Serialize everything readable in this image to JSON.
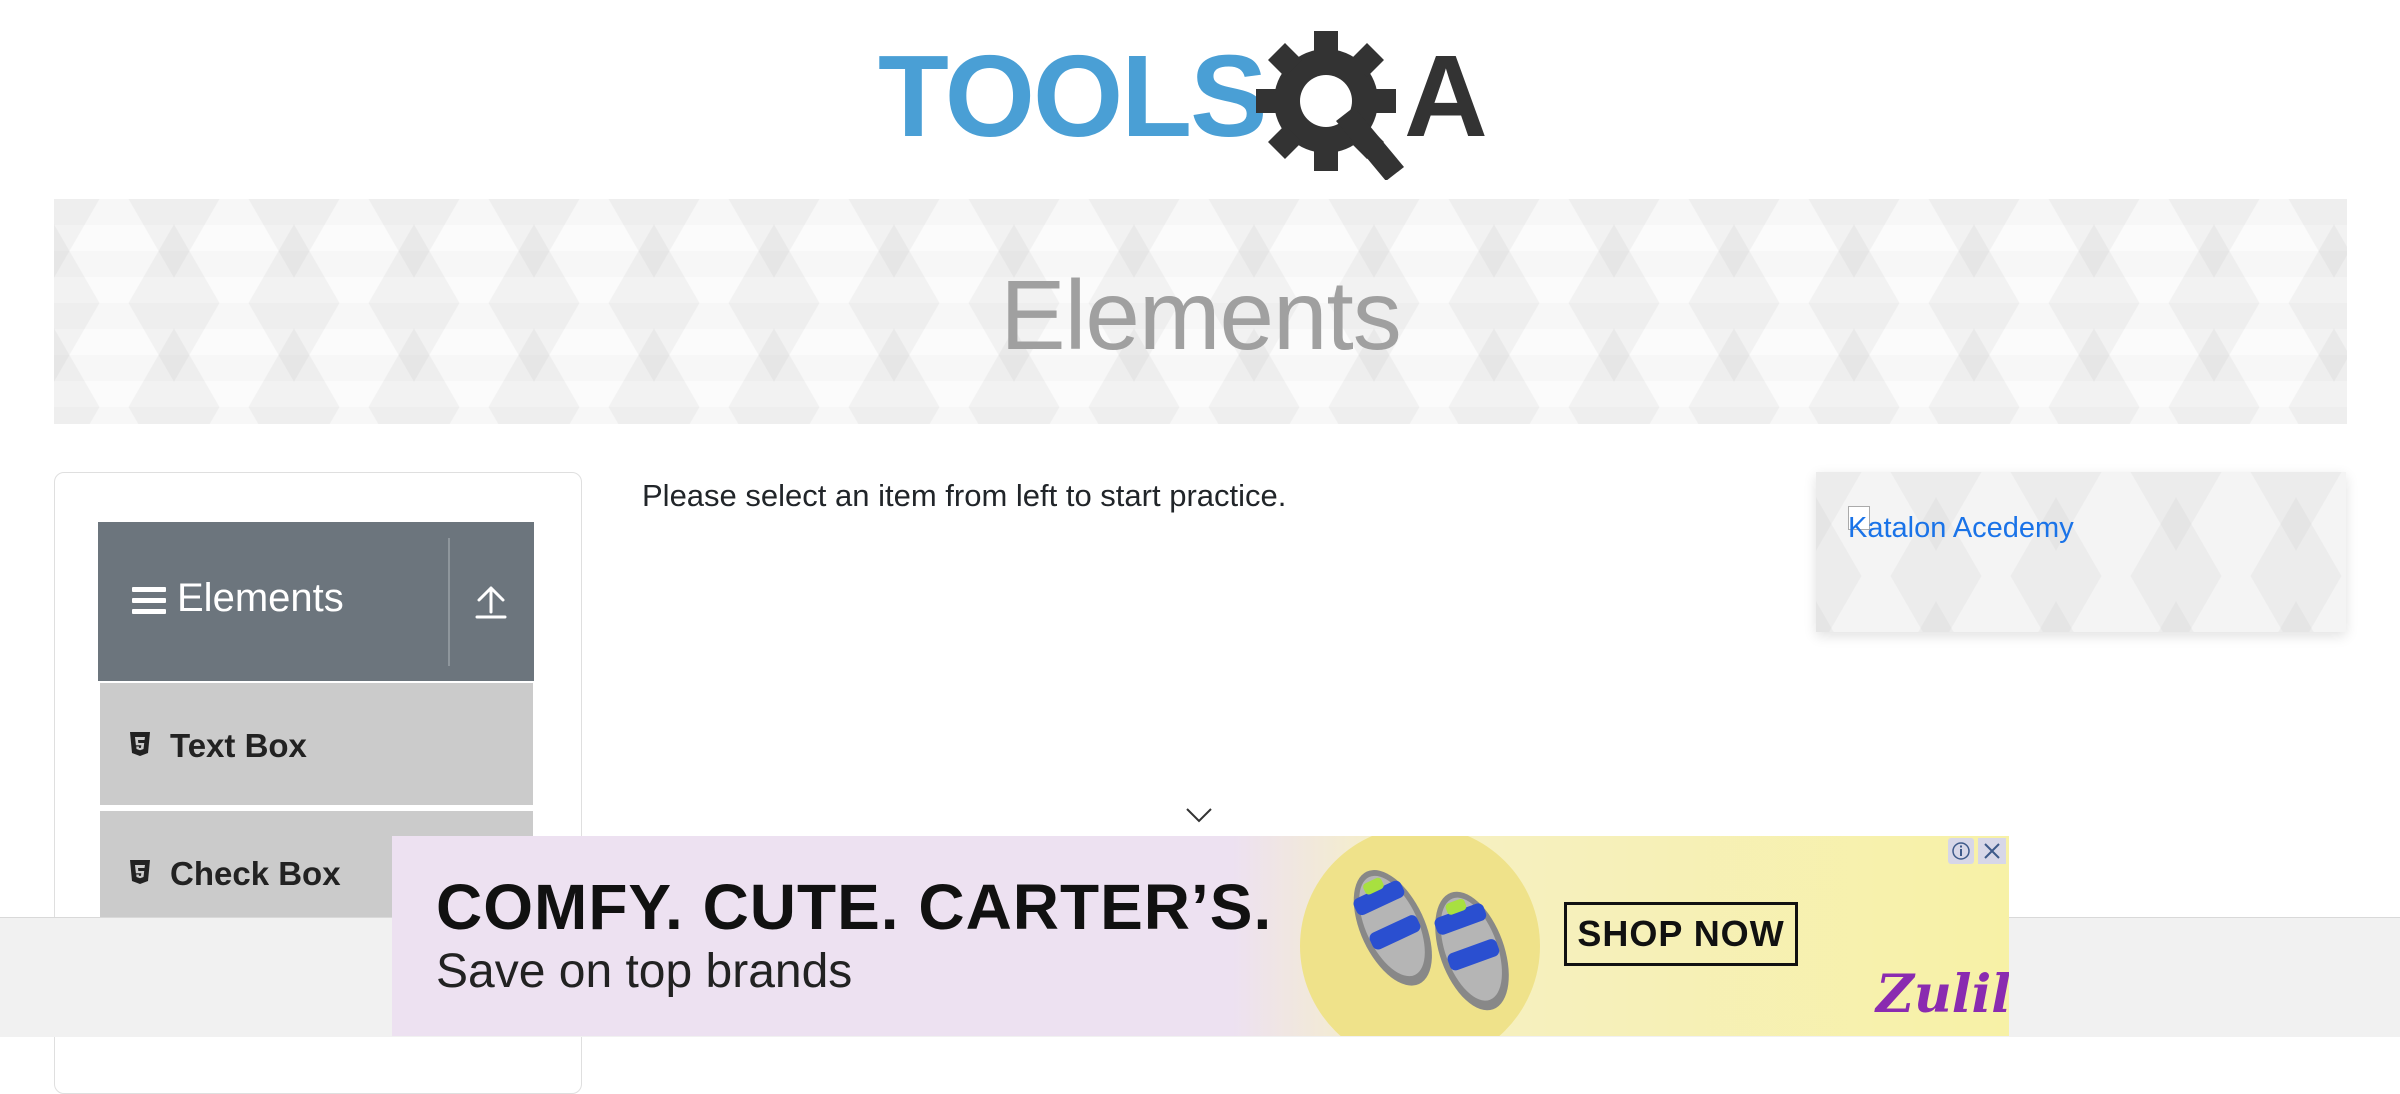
{
  "header": {
    "logo_text_left": "TOOLS",
    "logo_text_right": "A",
    "logo_alt": "ToolsQA"
  },
  "banner": {
    "title": "Elements"
  },
  "sidebar": {
    "group": {
      "label": "Elements",
      "icon": "hamburger-icon",
      "toggle_icon": "upload-arrow-icon"
    },
    "items": [
      {
        "label": "Text Box",
        "icon": "html5-icon"
      },
      {
        "label": "Check Box",
        "icon": "html5-icon"
      }
    ]
  },
  "main": {
    "intro": "Please select an item from left to start practice."
  },
  "side_ad": {
    "link_text": "Katalon Acedemy"
  },
  "bottom_ad": {
    "headline": "COMFY. CUTE. CARTER’S.",
    "subline": "Save on top brands",
    "cta": "SHOP NOW",
    "brand": "Zulily",
    "info_icon": "info-icon",
    "close_icon": "close-icon"
  },
  "colors": {
    "logo_blue": "#4a9fd5",
    "logo_dark": "#333333",
    "group_header": "#6c757d",
    "menu_item": "#cbcbcb",
    "link": "#1a73e8",
    "brand_purple": "#8a2bb0"
  }
}
